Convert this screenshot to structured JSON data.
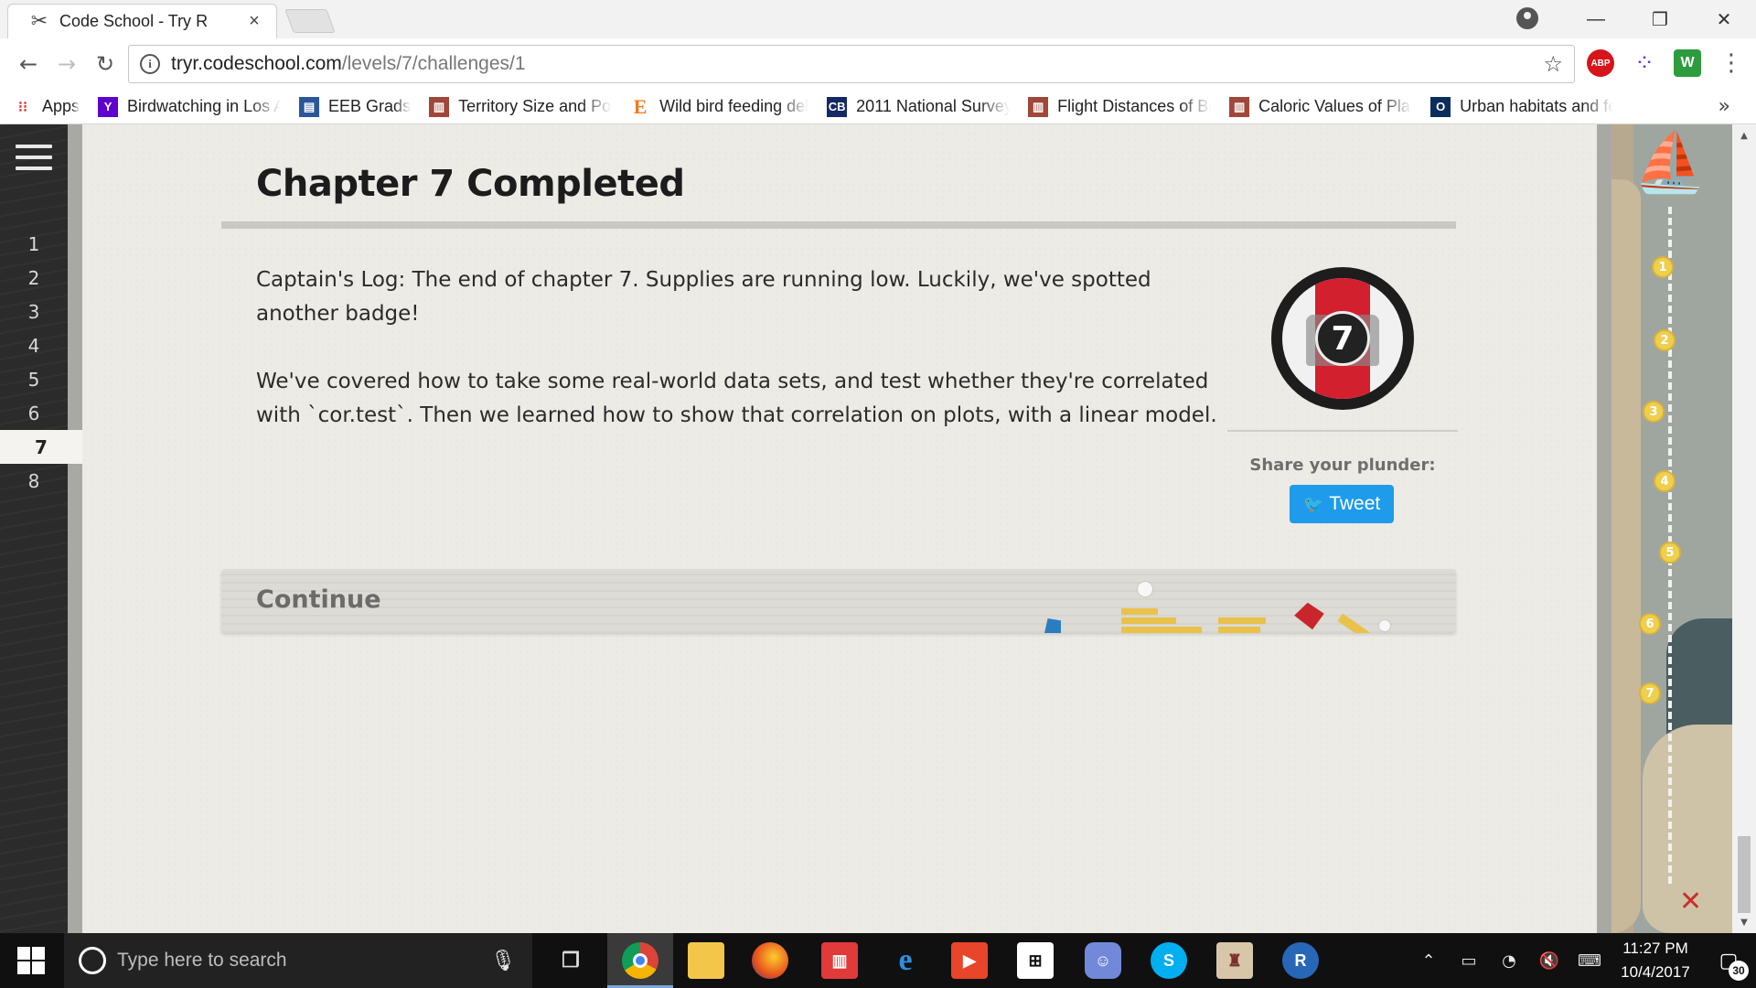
{
  "browser": {
    "tab_title": "Code School - Try R",
    "tab_close": "×",
    "url_host": "tryr.codeschool.com",
    "url_path": "/levels/7/challenges/1",
    "window_controls": {
      "minimize": "—",
      "restore": "❐",
      "close": "✕"
    }
  },
  "bookmarks": [
    {
      "label": "Apps",
      "icon": "apps-grid-icon"
    },
    {
      "label": "Birdwatching in Los A",
      "icon": "yahoo-icon",
      "color": "#5f01d1"
    },
    {
      "label": "EEB Grads",
      "icon": "calendar-icon",
      "color": "#2b579a"
    },
    {
      "label": "Territory Size and Pop",
      "icon": "journal-icon",
      "color": "#a0473a"
    },
    {
      "label": "Wild bird feeding del",
      "icon": "elsevier-icon",
      "color": "#ef7d22"
    },
    {
      "label": "2011 National Survey",
      "icon": "census-icon",
      "color": "#142866"
    },
    {
      "label": "Flight Distances of Bi",
      "icon": "journal-icon",
      "color": "#a0473a"
    },
    {
      "label": "Caloric Values of Plan",
      "icon": "journal-icon",
      "color": "#a0473a"
    },
    {
      "label": "Urban habitats and fe",
      "icon": "oxford-icon",
      "color": "#0b2d5e"
    }
  ],
  "bookmarks_more": "»",
  "sidebar": {
    "levels": [
      "1",
      "2",
      "3",
      "4",
      "5",
      "6",
      "7",
      "8"
    ],
    "active_level": "7"
  },
  "main": {
    "title": "Chapter 7 Completed",
    "paragraphs": [
      "Captain's Log: The end of chapter 7. Supplies are running low. Luckily, we've spotted another badge!",
      "We've covered how to take some real-world data sets, and test whether they're correlated with `cor.test`. Then we learned how to show that correlation on plots, with a linear model."
    ],
    "badge_number": "7",
    "share_label": "Share your plunder:",
    "tweet_label": "Tweet",
    "continue_label": "Continue"
  },
  "map": {
    "nodes": [
      "1",
      "2",
      "3",
      "4",
      "5",
      "6",
      "7"
    ],
    "end_marker": "✕"
  },
  "taskbar": {
    "search_placeholder": "Type here to search",
    "time": "11:27 PM",
    "date": "10/4/2017",
    "notification_count": "30"
  }
}
